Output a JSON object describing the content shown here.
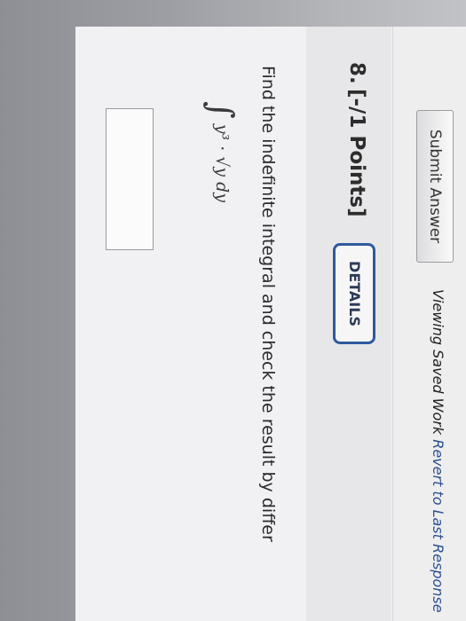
{
  "toolbar": {
    "submit_label": "Submit Answer",
    "saved_text": "Viewing Saved Work ",
    "revert_link": "Revert to Last Response"
  },
  "question": {
    "number": "8.",
    "points": "[-/1 Points]",
    "details_label": "DETAILS",
    "prompt": "Find the indefinite integral and check the result by differ",
    "integral_sign": "∫",
    "integrand": "y³ · √y dy"
  },
  "colors": {
    "link": "#2b4f8f",
    "details_border": "#2f5a9c",
    "sticky_note": "#e8de8e"
  }
}
